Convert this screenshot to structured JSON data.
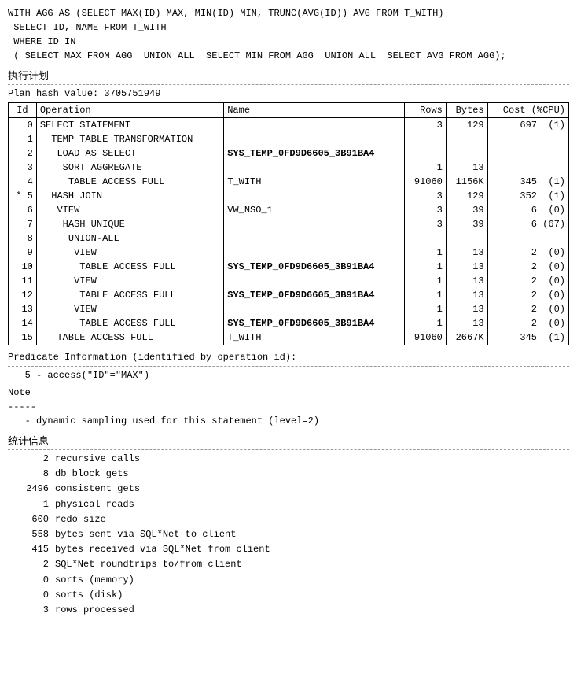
{
  "sql": {
    "line1": "WITH AGG AS (SELECT MAX(ID) MAX, MIN(ID) MIN, TRUNC(AVG(ID)) AVG FROM T_WITH)",
    "line2": " SELECT ID, NAME FROM T_WITH",
    "line3": " WHERE ID IN",
    "line4": " ( SELECT MAX FROM AGG  UNION ALL  SELECT MIN FROM AGG  UNION ALL  SELECT AVG FROM AGG);",
    "exec_plan_label": "执行计划"
  },
  "plan": {
    "hash_label": "Plan hash value: 3705751949",
    "headers": {
      "id": " Id ",
      "operation": "Operation",
      "name": " Name",
      "rows": "Rows ",
      "bytes": " Bytes ",
      "cost": "Cost (%CPU)"
    },
    "rows": [
      {
        "id": "  0",
        "star": false,
        "operation": "SELECT STATEMENT           ",
        "name": "",
        "rows": "   3",
        "bytes": "  129",
        "cost": " 697  (1)"
      },
      {
        "id": "  1",
        "star": false,
        "operation": "  TEMP TABLE TRANSFORMATION",
        "name": "",
        "rows": "",
        "bytes": "",
        "cost": ""
      },
      {
        "id": "  2",
        "star": false,
        "operation": "   LOAD AS SELECT          ",
        "name": "SYS_TEMP_0FD9D6605_3B91BA4",
        "bold": true,
        "rows": "",
        "bytes": "",
        "cost": ""
      },
      {
        "id": "  3",
        "star": false,
        "operation": "    SORT AGGREGATE         ",
        "name": "",
        "rows": "   1",
        "bytes": "   13",
        "cost": ""
      },
      {
        "id": "  4",
        "star": false,
        "operation": "     TABLE ACCESS FULL     ",
        "name": "T_WITH",
        "rows": "91060",
        "bytes": "1156K",
        "cost": " 345  (1)"
      },
      {
        "id": "* 5",
        "star": true,
        "operation": "  HASH JOIN                ",
        "name": "",
        "rows": "   3",
        "bytes": "  129",
        "cost": " 352  (1)"
      },
      {
        "id": "  6",
        "star": false,
        "operation": "   VIEW                    ",
        "name": "VW_NSO_1",
        "rows": "   3",
        "bytes": "   39",
        "cost": "   6  (0)"
      },
      {
        "id": "  7",
        "star": false,
        "operation": "    HASH UNIQUE            ",
        "name": "",
        "rows": "   3",
        "bytes": "   39",
        "cost": "   6 (67)"
      },
      {
        "id": "  8",
        "star": false,
        "operation": "     UNION-ALL             ",
        "name": "",
        "rows": "",
        "bytes": "",
        "cost": ""
      },
      {
        "id": "  9",
        "star": false,
        "operation": "      VIEW                 ",
        "name": "",
        "rows": "   1",
        "bytes": "   13",
        "cost": "   2  (0)"
      },
      {
        "id": " 10",
        "star": false,
        "operation": "       TABLE ACCESS FULL   ",
        "name": "SYS_TEMP_0FD9D6605_3B91BA4",
        "bold": true,
        "rows": "   1",
        "bytes": "   13",
        "cost": "   2  (0)"
      },
      {
        "id": " 11",
        "star": false,
        "operation": "      VIEW                 ",
        "name": "",
        "rows": "   1",
        "bytes": "   13",
        "cost": "   2  (0)"
      },
      {
        "id": " 12",
        "star": false,
        "operation": "       TABLE ACCESS FULL   ",
        "name": "SYS_TEMP_0FD9D6605_3B91BA4",
        "bold": true,
        "rows": "   1",
        "bytes": "   13",
        "cost": "   2  (0)"
      },
      {
        "id": " 13",
        "star": false,
        "operation": "      VIEW                 ",
        "name": "",
        "rows": "   1",
        "bytes": "   13",
        "cost": "   2  (0)"
      },
      {
        "id": " 14",
        "star": false,
        "operation": "       TABLE ACCESS FULL   ",
        "name": "SYS_TEMP_0FD9D6605_3B91BA4",
        "bold": true,
        "rows": "   1",
        "bytes": "   13",
        "cost": "   2  (0)"
      },
      {
        "id": " 15",
        "star": false,
        "operation": "   TABLE ACCESS FULL       ",
        "name": "T_WITH",
        "rows": "91060",
        "bytes": "2667K",
        "cost": " 345  (1)"
      }
    ]
  },
  "predicate": {
    "title": "Predicate Information (identified by operation id):",
    "items": [
      "   5 - access(\"ID\"=\"MAX\")"
    ],
    "note_title": "Note",
    "note_divider": "-----",
    "note_items": [
      "   - dynamic sampling used for this statement (level=2)"
    ]
  },
  "stats": {
    "title": "统计信息",
    "rows": [
      {
        "num": "2",
        "label": "recursive calls"
      },
      {
        "num": "8",
        "label": "db block gets"
      },
      {
        "num": "2496",
        "label": "consistent gets"
      },
      {
        "num": "1",
        "label": "physical reads"
      },
      {
        "num": "600",
        "label": "redo size"
      },
      {
        "num": "558",
        "label": "bytes sent via SQL*Net to client"
      },
      {
        "num": "415",
        "label": "bytes received via SQL*Net from client"
      },
      {
        "num": "2",
        "label": "SQL*Net roundtrips to/from client"
      },
      {
        "num": "0",
        "label": "sorts (memory)"
      },
      {
        "num": "0",
        "label": "sorts (disk)"
      },
      {
        "num": "3",
        "label": "rows processed"
      }
    ]
  }
}
